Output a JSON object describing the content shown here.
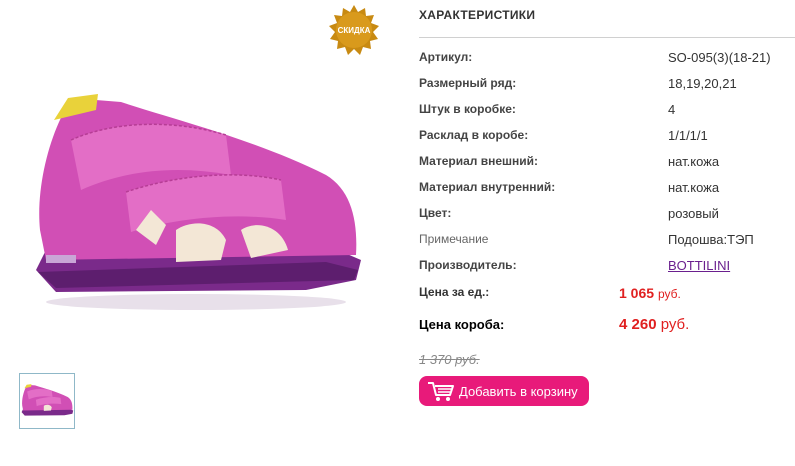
{
  "badge": {
    "label": "СКИДКА"
  },
  "section_title": "ХАРАКТЕРИСТИКИ",
  "specs": [
    {
      "label": "Артикул:",
      "value": "SO-095(3)(18-21)"
    },
    {
      "label": "Размерный ряд:",
      "value": "18,19,20,21"
    },
    {
      "label": "Штук в коробке:",
      "value": "4"
    },
    {
      "label": "Расклад в коробе:",
      "value": "1/1/1/1"
    },
    {
      "label": "Материал внешний:",
      "value": "нат.кожа"
    },
    {
      "label": "Материал внутренний:",
      "value": "нат.кожа"
    },
    {
      "label": "Цвет:",
      "value": "розовый"
    },
    {
      "label": "Примечание",
      "value": "Подошва:ТЭП"
    },
    {
      "label": "Производитель:",
      "value": "BOTTILINI"
    }
  ],
  "unit_price": {
    "label": "Цена за ед.:",
    "amount": "1 065",
    "currency": "руб."
  },
  "box_price": {
    "label": "Цена короба:",
    "amount": "4 260",
    "currency": "руб."
  },
  "old_price": {
    "amount": "1 370",
    "currency": "руб."
  },
  "cart_button": {
    "label": "Добавить в корзину"
  },
  "colors": {
    "accent": "#e81a7a",
    "price": "#e02020",
    "shoe": "#d14fb5"
  },
  "icons": {
    "cart": "cart-icon"
  }
}
